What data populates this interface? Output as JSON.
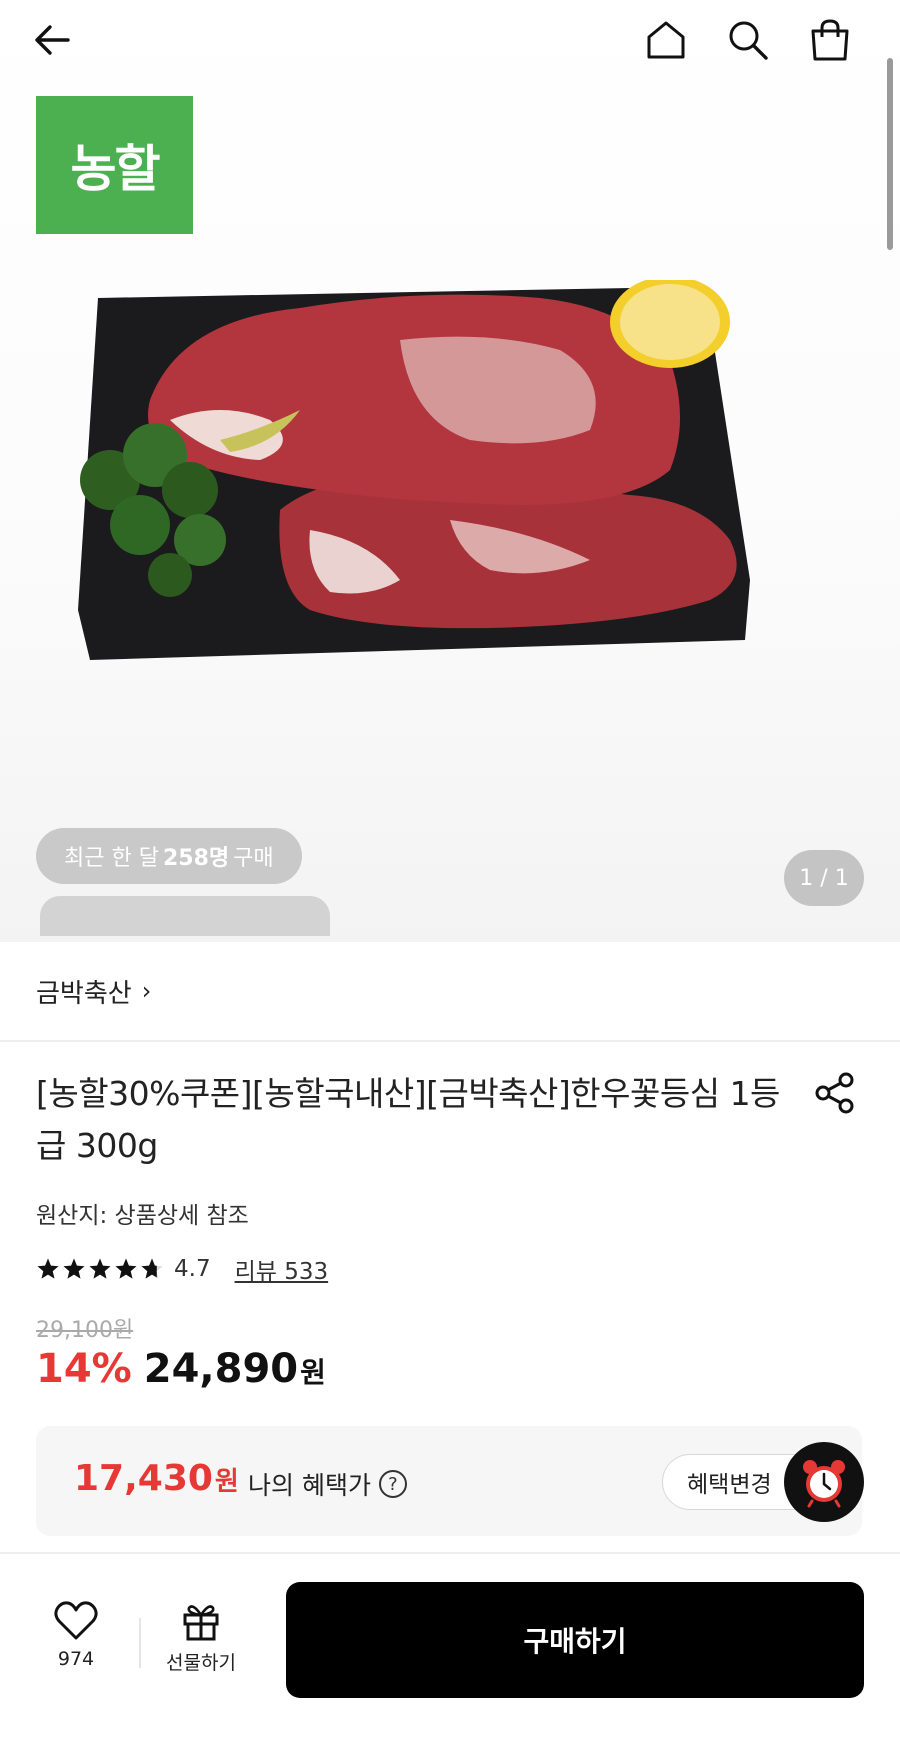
{
  "header": {
    "back_icon": "arrow-left-icon",
    "home_icon": "home-icon",
    "search_icon": "search-icon",
    "cart_icon": "shopping-bag-icon"
  },
  "hero": {
    "brand_logo_text": "농할",
    "brand_logo_color": "#4caf50",
    "purchase_prefix": "최근 한 달",
    "purchase_count": "258명",
    "purchase_suffix": "구매",
    "pager": "1 / 1"
  },
  "shop": {
    "name": "금박축산",
    "chevron": "›"
  },
  "product": {
    "title": "[농할30%쿠폰][농할국내산][금박축산]한우꽃등심 1등급 300g",
    "share_icon": "share-icon",
    "origin": "원산지: 상품상세 참조",
    "rating": 4.7,
    "rating_text": "4.7",
    "review_link": "리뷰 533",
    "original_price": "29,100원",
    "discount": "14%",
    "price": "24,890",
    "currency": "원",
    "accent_color": "#e53935"
  },
  "benefit": {
    "price": "17,430",
    "currency": "원",
    "label": "나의 혜택가",
    "help_icon": "question-icon",
    "change_button": "혜택변경",
    "alarm_icon": "alarm-clock-icon"
  },
  "bottom_bar": {
    "like_icon": "heart-icon",
    "like_count": "974",
    "gift_icon": "gift-icon",
    "gift_label": "선물하기",
    "buy_button": "구매하기"
  }
}
